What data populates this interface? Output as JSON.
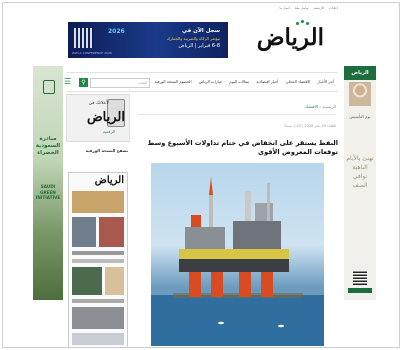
{
  "topbar": {
    "items": [
      "إعلانات",
      "الأرشيف",
      "تواصل معنا",
      "اتصل بنا"
    ]
  },
  "site": {
    "logo": "الرياض"
  },
  "ad_banner": {
    "line1": "سجل الآن في",
    "line2": "مؤتمر الزكاة والضريبة والجمارك",
    "line3": "6-8 فبراير | الرياض",
    "line4": "ZATCA CONFERENCE 2026",
    "year": "2026"
  },
  "nav": {
    "items": [
      "أخر الأخبار",
      "الاقتصاد المحلي",
      "أخبار اقتصادية",
      "مقالات اليوم",
      "خيارات الرياض",
      "الخصوم النسخة الورقية"
    ],
    "search_placeholder": "البحث"
  },
  "breadcrumb": {
    "home": "الرئيسية",
    "current": "الاقتصاد"
  },
  "article": {
    "meta": "الثلاثاء 20 يناير 2026 | 1:23 مساءً",
    "headline": "النفط يستقر على انخفاض في ختام تداولات الأسبوع وسط توقعات المعروض الأقوى"
  },
  "sidebar": {
    "promo_line1": "لأعلانك في",
    "promo_logo": "الرياض",
    "promo_line3": "الرقمية",
    "pdf_label": "تصفح النسخة الورقية",
    "paper_masthead": "الرياض"
  },
  "left_ad": {
    "text_ar": "مبادرة السعودية الخضراء",
    "text_en": "SAUDI GREEN INITIATIVE"
  },
  "right_ad": {
    "header": "الرياض",
    "caption": "يوم التأسيس",
    "big_text": "تهنئ بالأيام الباهية نوافي الصف"
  }
}
